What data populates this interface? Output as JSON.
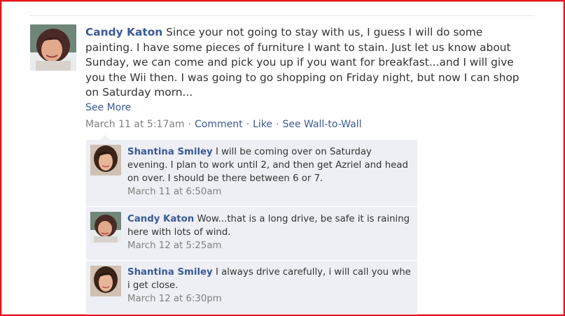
{
  "post": {
    "author": "Candy Katon",
    "text": "Since your not going to stay with us, I guess I will do some painting. I have some pieces of furniture I want to stain. Just let us know about Sunday, we can come and pick you up if you want for breakfast...and I will give you the Wii then. I was going to go shopping on Friday night, but now I can shop on Saturday morn...",
    "see_more": "See More",
    "timestamp": "March 11 at 5:17am",
    "actions": [
      "Comment",
      "Like",
      "See Wall-to-Wall"
    ],
    "separator": "·"
  },
  "comments": [
    {
      "author": "Shantina Smiley",
      "text": "I will be coming over on Saturday evening. I plan to work until 2, and then get Azriel and head on over. I should be there between 6 or 7.",
      "timestamp": "March 11 at 6:50am"
    },
    {
      "author": "Candy Katon",
      "text": "Wow...that is a long drive, be safe it is raining here with lots of wind.",
      "timestamp": "March 12 at 5:25am"
    },
    {
      "author": "Shantina Smiley",
      "text": "I always drive carefully, i will call you whe i get close.",
      "timestamp": "March 12 at 6:30pm"
    }
  ],
  "colors": {
    "link": "#3b5998",
    "text": "#333333",
    "meta": "#808080",
    "comment_bg": "#edeff4",
    "frame": "#e8131b"
  }
}
